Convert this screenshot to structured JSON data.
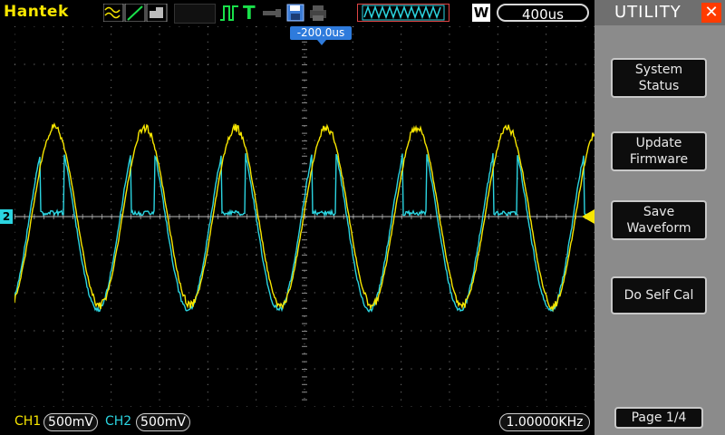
{
  "header": {
    "brand": "Hantek",
    "timebase": "400us",
    "trigger_position": "-200.0us",
    "mode_letter": "W"
  },
  "icons": {
    "waveform_modes": "waveform-mode-icons",
    "run_state": "pulse-icon",
    "trigger_t": "T",
    "probe": "probe-icon",
    "save": "floppy-icon",
    "print": "printer-icon"
  },
  "sidebar": {
    "title": "UTILITY",
    "buttons": [
      {
        "label_line1": "System",
        "label_line2": "Status"
      },
      {
        "label_line1": "Update",
        "label_line2": "Firmware"
      },
      {
        "label_line1": "Save",
        "label_line2": "Waveform"
      },
      {
        "label_line1": "Do Self Cal",
        "label_line2": ""
      }
    ],
    "page": "Page 1/4"
  },
  "footer": {
    "ch1_label": "CH1",
    "ch1_scale": "500mV",
    "ch2_label": "CH2",
    "ch2_scale": "500mV",
    "frequency": "1.00000KHz"
  },
  "markers": {
    "ch2_ref": "2"
  },
  "colors": {
    "ch1": "#f7e600",
    "ch2": "#2bd4e0",
    "background": "#000000",
    "panel": "#8b8b8b",
    "accent": "#ff3b00"
  },
  "waveforms": {
    "cycles_visible": 6.4,
    "ch1_shape": "sine",
    "ch2_shape": "clipped-sine"
  }
}
